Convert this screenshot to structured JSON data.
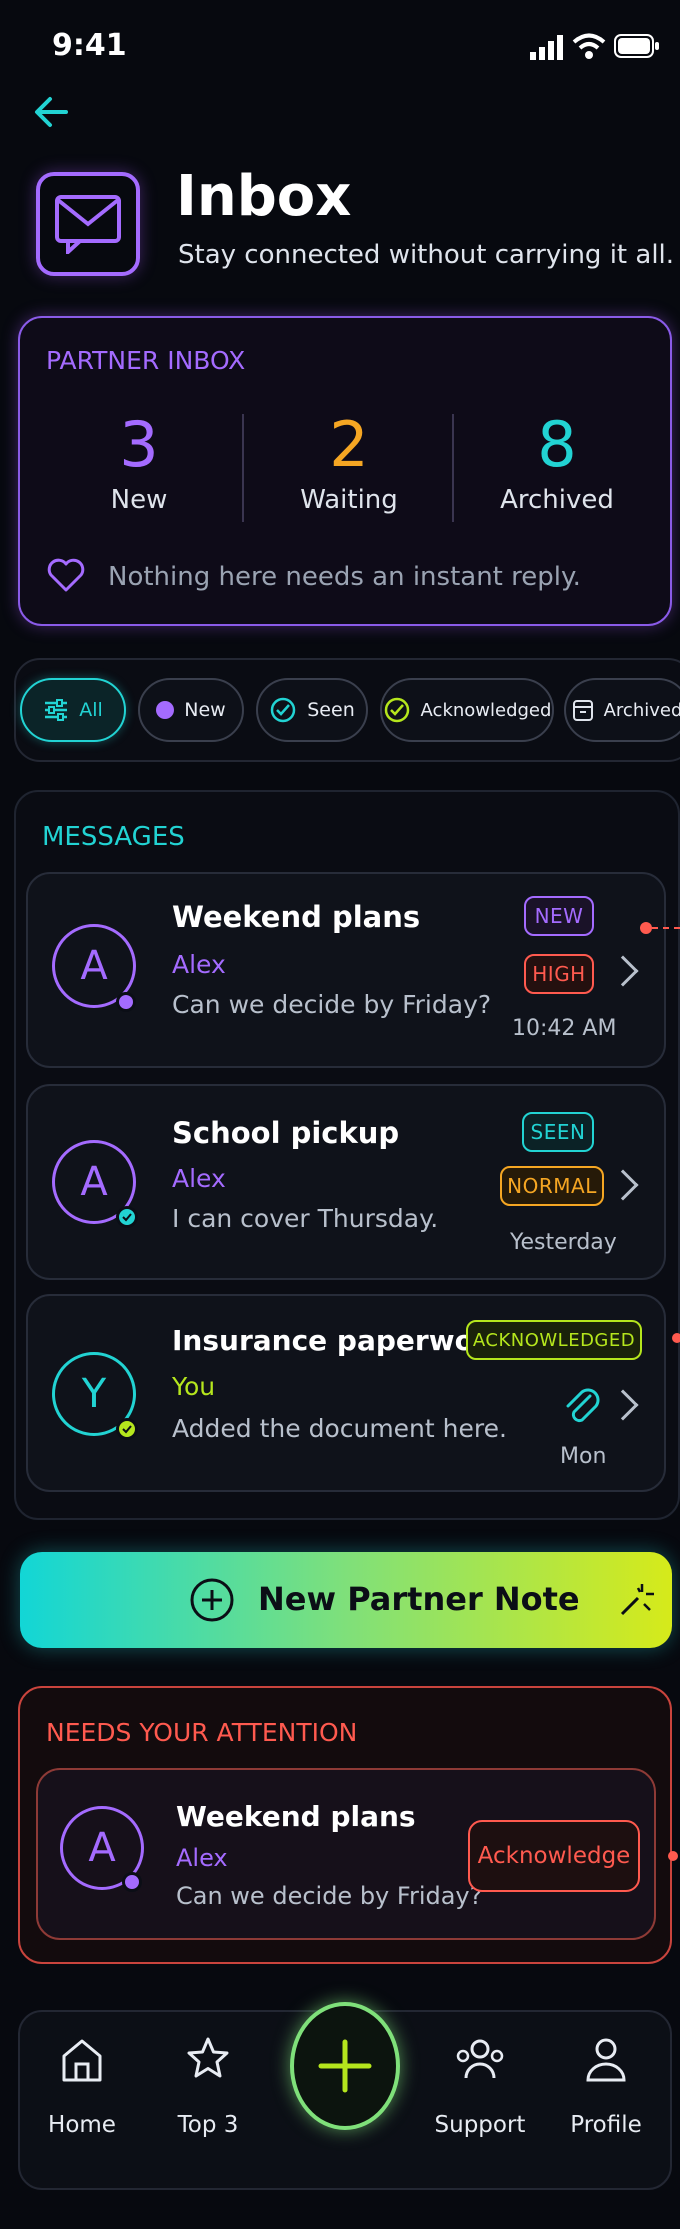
{
  "status_bar": {
    "time": "9:41"
  },
  "header": {
    "title": "Inbox",
    "subtitle": "Stay connected without carrying it all."
  },
  "partner_inbox": {
    "heading": "PARTNER INBOX",
    "stats": [
      {
        "value": "3",
        "label": "New",
        "color": "#a46bff"
      },
      {
        "value": "2",
        "label": "Waiting",
        "color": "#f5a623"
      },
      {
        "value": "8",
        "label": "Archived",
        "color": "#22d3d3"
      }
    ],
    "note": "Nothing here needs an instant reply."
  },
  "filters": [
    {
      "label": "All",
      "icon": "sliders-icon",
      "active": true
    },
    {
      "label": "New",
      "icon": "purple-dot-icon"
    },
    {
      "label": "Seen",
      "icon": "check-circle-icon"
    },
    {
      "label": "Acknowledged",
      "icon": "check-badge-icon"
    },
    {
      "label": "Archived",
      "icon": "archive-box-icon"
    }
  ],
  "messages": {
    "heading": "MESSAGES",
    "items": [
      {
        "avatar": "A",
        "title": "Weekend plans",
        "sender": "Alex",
        "preview": "Can we decide by Friday?",
        "status": "NEW",
        "priority": "HIGH",
        "time": "10:42 AM"
      },
      {
        "avatar": "A",
        "title": "School pickup",
        "sender": "Alex",
        "preview": "I can cover Thursday.",
        "status": "SEEN",
        "priority": "NORMAL",
        "time": "Yesterday"
      },
      {
        "avatar": "Y",
        "title": "Insurance paperwork",
        "sender": "You",
        "preview": "Added the document here.",
        "status": "ACKNOWLEDGED",
        "time": "Mon"
      }
    ]
  },
  "cta": {
    "label": "New Partner Note"
  },
  "attention": {
    "heading": "NEEDS YOUR ATTENTION",
    "item": {
      "avatar": "A",
      "title": "Weekend plans",
      "sender": "Alex",
      "preview": "Can we decide by Friday?",
      "action": "Acknowledge"
    }
  },
  "bottom_nav": [
    {
      "label": "Home",
      "icon": "home-icon"
    },
    {
      "label": "Top 3",
      "icon": "star-icon"
    },
    {
      "label": "",
      "icon": "plus-icon"
    },
    {
      "label": "Support",
      "icon": "support-people-icon"
    },
    {
      "label": "Profile",
      "icon": "profile-icon"
    }
  ],
  "colors": {
    "purple": "#a46bff",
    "cyan": "#22d3d3",
    "orange": "#f5a623",
    "lime": "#b5e61d",
    "red": "#ff5a4f",
    "green": "#5ee65e"
  }
}
